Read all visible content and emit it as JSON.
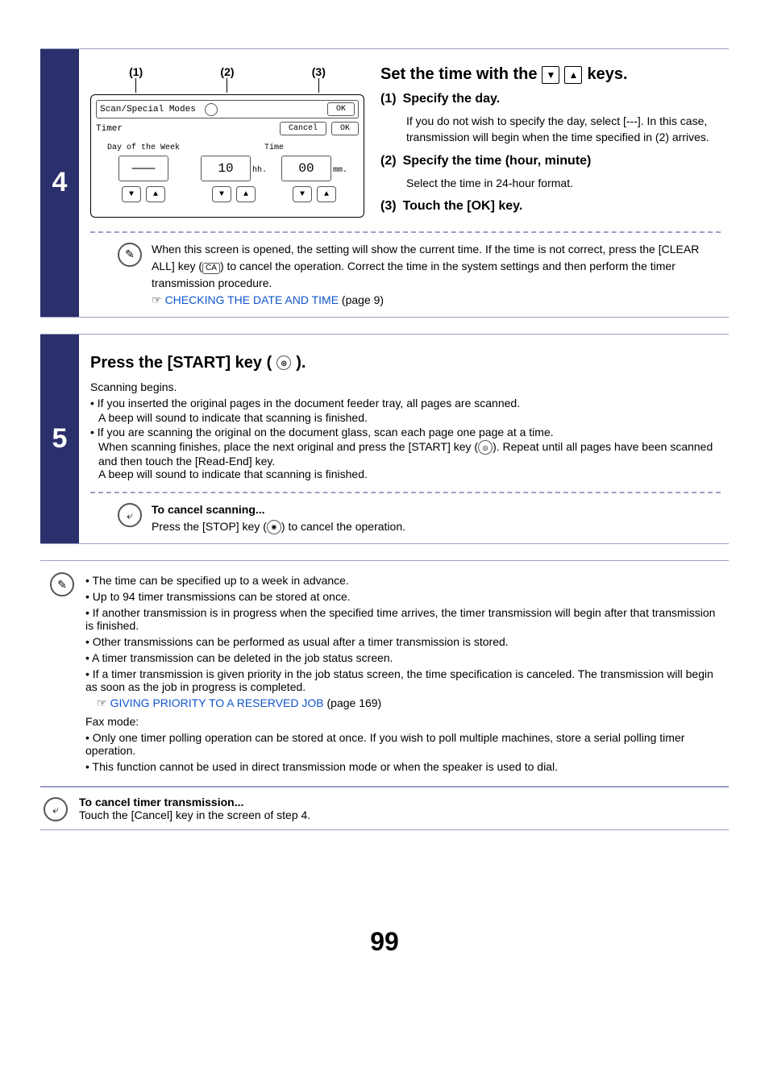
{
  "step4": {
    "number": "4",
    "callouts": {
      "c1": "(1)",
      "c2": "(2)",
      "c3": "(3)"
    },
    "ui": {
      "breadcrumb": "Scan/Special Modes",
      "subtitle": "Timer",
      "ok_top": "OK",
      "cancel": "Cancel",
      "ok_mid": "OK",
      "day_label": "Day of the Week",
      "day_value": "———",
      "time_label": "Time",
      "hh_value": "10",
      "hh_unit": "hh.",
      "mm_value": "00",
      "mm_unit": "mm."
    },
    "heading_a": "Set the time with the ",
    "heading_b": " keys.",
    "s1_num": "(1)",
    "s1_title": "Specify the day.",
    "s1_desc": "If you do not wish to specify the day, select [---]. In this case, transmission will begin when the time specified in (2) arrives.",
    "s2_num": "(2)",
    "s2_title": "Specify the time (hour, minute)",
    "s2_desc": "Select the time in 24-hour format.",
    "s3_num": "(3)",
    "s3_title": "Touch the [OK] key.",
    "note": {
      "pre": "When this screen is opened, the setting will show the current time. If the time is not correct, press the [CLEAR ALL] key (",
      "ca": "CA",
      "post": ") to cancel the operation. Correct the time in the system settings and then perform the timer transmission procedure.",
      "pointer": "☞",
      "link": "CHECKING THE DATE AND TIME",
      "page": " (page 9)"
    }
  },
  "step5": {
    "number": "5",
    "heading_a": "Press the [START] key (",
    "heading_b": ").",
    "line1": "Scanning begins.",
    "b1": "If you inserted the original pages in the document feeder tray, all pages are scanned.",
    "b1b": "A beep will sound to indicate that scanning is finished.",
    "b2": "If you are scanning the original on the document glass, scan each page one page at a time.",
    "b2b_a": "When scanning finishes, place the next original and press the [START] key (",
    "b2b_b": "). Repeat until all pages have been scanned and then touch the [Read-End] key.",
    "b2c": "A beep will sound to indicate that scanning is finished.",
    "cancel_title": "To cancel scanning...",
    "cancel_body_a": "Press the [STOP] key (",
    "cancel_body_b": ") to cancel the operation."
  },
  "notes": {
    "n1": "The time can be specified up to a week in advance.",
    "n2": "Up to 94 timer transmissions can be stored at once.",
    "n3": "If another transmission is in progress when the specified time arrives, the timer transmission will begin after that transmission is finished.",
    "n4": "Other transmissions can be performed as usual after a timer transmission is stored.",
    "n5": "A timer transmission can be deleted in the job status screen.",
    "n6": "If a timer transmission is given priority in the job status screen, the time specification is canceled. The transmission will begin as soon as the job in progress is completed.",
    "n6_pointer": "☞",
    "n6_link": "GIVING PRIORITY TO A RESERVED JOB",
    "n6_page": " (page 169)",
    "fax_heading": "Fax mode:",
    "f1": "Only one timer polling operation can be stored at once. If you wish to poll multiple machines, store a serial polling timer operation.",
    "f2": "This function cannot be used in direct transmission mode or when the speaker is used to dial."
  },
  "footer": {
    "title": "To cancel timer transmission...",
    "body": "Touch the [Cancel] key in the screen of step 4."
  },
  "page_number": "99",
  "glyphs": {
    "down": "▼",
    "up": "▲",
    "stop": "◉",
    "start": "◎",
    "back": "⤶",
    "pencil": "✎"
  }
}
